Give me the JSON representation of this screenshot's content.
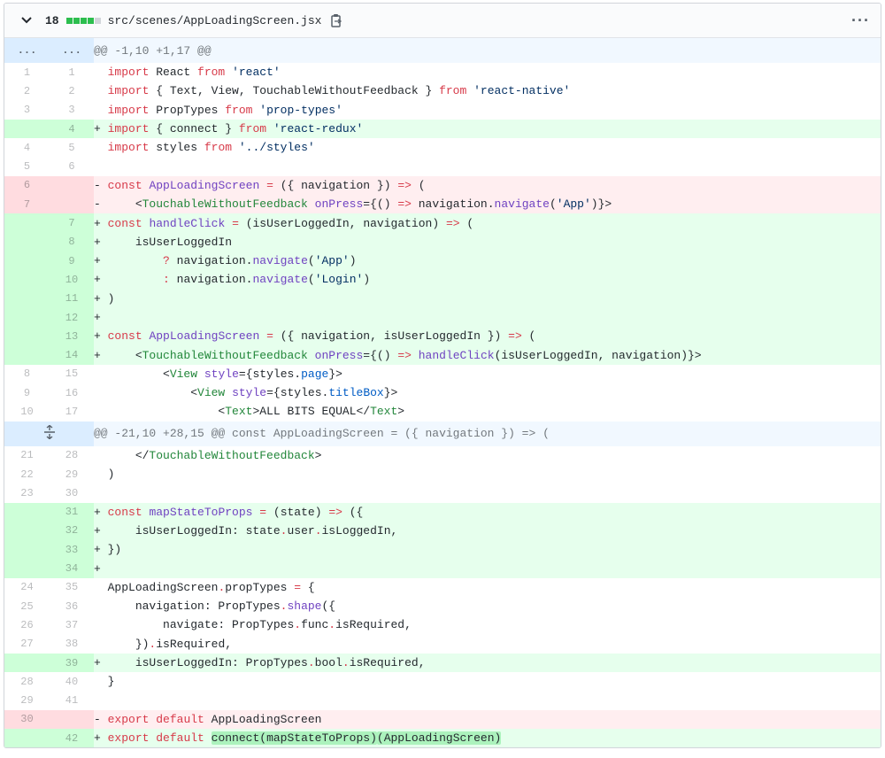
{
  "file": {
    "changes": "18",
    "stat_blocks": [
      "#2cbe4e",
      "#2cbe4e",
      "#2cbe4e",
      "#2cbe4e",
      "#d1d5da"
    ],
    "path": "src/scenes/AppLoadingScreen.jsx",
    "copy_icon": "clippy-icon",
    "menu_icon": "kebab-horizontal-icon",
    "menu_label": "···"
  },
  "hunks": [
    {
      "expander": "...",
      "expander2": "...",
      "header": "@@ -1,10 +1,17 @@"
    },
    {
      "expander": "unfold-icon",
      "header": "@@ -21,10 +28,15 @@ const AppLoadingScreen = ({ navigation }) => ("
    }
  ],
  "lines": [
    {
      "type": "ctx",
      "old": "1",
      "new": "1",
      "prefix": " ",
      "code": [
        {
          "t": "import",
          "c": "k"
        },
        {
          "t": " React "
        },
        {
          "t": "from",
          "c": "k"
        },
        {
          "t": " "
        },
        {
          "t": "'react'",
          "c": "s"
        }
      ]
    },
    {
      "type": "ctx",
      "old": "2",
      "new": "2",
      "prefix": " ",
      "code": [
        {
          "t": "import",
          "c": "k"
        },
        {
          "t": " { Text, View, TouchableWithoutFeedback } "
        },
        {
          "t": "from",
          "c": "k"
        },
        {
          "t": " "
        },
        {
          "t": "'react-native'",
          "c": "s"
        }
      ]
    },
    {
      "type": "ctx",
      "old": "3",
      "new": "3",
      "prefix": " ",
      "code": [
        {
          "t": "import",
          "c": "k"
        },
        {
          "t": " PropTypes "
        },
        {
          "t": "from",
          "c": "k"
        },
        {
          "t": " "
        },
        {
          "t": "'prop-types'",
          "c": "s"
        }
      ]
    },
    {
      "type": "add",
      "old": "",
      "new": "4",
      "prefix": "+",
      "code": [
        {
          "t": "import",
          "c": "k"
        },
        {
          "t": " { connect } "
        },
        {
          "t": "from",
          "c": "k"
        },
        {
          "t": " "
        },
        {
          "t": "'react-redux'",
          "c": "s"
        }
      ]
    },
    {
      "type": "ctx",
      "old": "4",
      "new": "5",
      "prefix": " ",
      "code": [
        {
          "t": "import",
          "c": "k"
        },
        {
          "t": " styles "
        },
        {
          "t": "from",
          "c": "k"
        },
        {
          "t": " "
        },
        {
          "t": "'../styles'",
          "c": "s"
        }
      ]
    },
    {
      "type": "ctx",
      "old": "5",
      "new": "6",
      "prefix": " ",
      "code": []
    },
    {
      "type": "del",
      "old": "6",
      "new": "",
      "prefix": "-",
      "code": [
        {
          "t": "const",
          "c": "k"
        },
        {
          "t": " "
        },
        {
          "t": "AppLoadingScreen",
          "c": "f"
        },
        {
          "t": " "
        },
        {
          "t": "=",
          "c": "k"
        },
        {
          "t": " ({ navigation }) "
        },
        {
          "t": "=>",
          "c": "k"
        },
        {
          "t": " ("
        }
      ]
    },
    {
      "type": "del",
      "old": "7",
      "new": "",
      "prefix": "-",
      "code": [
        {
          "t": "    <"
        },
        {
          "t": "TouchableWithoutFeedback",
          "c": "t"
        },
        {
          "t": " "
        },
        {
          "t": "onPress",
          "c": "f"
        },
        {
          "t": "="
        },
        {
          "t": "{() "
        },
        {
          "t": "=>",
          "c": "k"
        },
        {
          "t": " navigation."
        },
        {
          "t": "navigate",
          "c": "f"
        },
        {
          "t": "("
        },
        {
          "t": "'App'",
          "c": "s"
        },
        {
          "t": ")}>"
        }
      ]
    },
    {
      "type": "add",
      "old": "",
      "new": "7",
      "prefix": "+",
      "code": [
        {
          "t": "const",
          "c": "k"
        },
        {
          "t": " "
        },
        {
          "t": "handleClick",
          "c": "f"
        },
        {
          "t": " "
        },
        {
          "t": "=",
          "c": "k"
        },
        {
          "t": " (isUserLoggedIn, navigation) "
        },
        {
          "t": "=>",
          "c": "k"
        },
        {
          "t": " ("
        }
      ]
    },
    {
      "type": "add",
      "old": "",
      "new": "8",
      "prefix": "+",
      "code": [
        {
          "t": "    isUserLoggedIn"
        }
      ]
    },
    {
      "type": "add",
      "old": "",
      "new": "9",
      "prefix": "+",
      "code": [
        {
          "t": "        "
        },
        {
          "t": "?",
          "c": "k"
        },
        {
          "t": " navigation."
        },
        {
          "t": "navigate",
          "c": "f"
        },
        {
          "t": "("
        },
        {
          "t": "'App'",
          "c": "s"
        },
        {
          "t": ")"
        }
      ]
    },
    {
      "type": "add",
      "old": "",
      "new": "10",
      "prefix": "+",
      "code": [
        {
          "t": "        "
        },
        {
          "t": ":",
          "c": "k"
        },
        {
          "t": " navigation."
        },
        {
          "t": "navigate",
          "c": "f"
        },
        {
          "t": "("
        },
        {
          "t": "'Login'",
          "c": "s"
        },
        {
          "t": ")"
        }
      ]
    },
    {
      "type": "add",
      "old": "",
      "new": "11",
      "prefix": "+",
      "code": [
        {
          "t": ")"
        }
      ]
    },
    {
      "type": "add",
      "old": "",
      "new": "12",
      "prefix": "+",
      "code": []
    },
    {
      "type": "add",
      "old": "",
      "new": "13",
      "prefix": "+",
      "code": [
        {
          "t": "const",
          "c": "k"
        },
        {
          "t": " "
        },
        {
          "t": "AppLoadingScreen",
          "c": "f"
        },
        {
          "t": " "
        },
        {
          "t": "=",
          "c": "k"
        },
        {
          "t": " ({ navigation, isUserLoggedIn }) "
        },
        {
          "t": "=>",
          "c": "k"
        },
        {
          "t": " ("
        }
      ]
    },
    {
      "type": "add",
      "old": "",
      "new": "14",
      "prefix": "+",
      "code": [
        {
          "t": "    <"
        },
        {
          "t": "TouchableWithoutFeedback",
          "c": "t"
        },
        {
          "t": " "
        },
        {
          "t": "onPress",
          "c": "f"
        },
        {
          "t": "="
        },
        {
          "t": "{() "
        },
        {
          "t": "=>",
          "c": "k"
        },
        {
          "t": " "
        },
        {
          "t": "handleClick",
          "c": "f"
        },
        {
          "t": "(isUserLoggedIn, navigation)}>"
        }
      ]
    },
    {
      "type": "ctx",
      "old": "8",
      "new": "15",
      "prefix": " ",
      "code": [
        {
          "t": "        <"
        },
        {
          "t": "View",
          "c": "t"
        },
        {
          "t": " "
        },
        {
          "t": "style",
          "c": "f"
        },
        {
          "t": "="
        },
        {
          "t": "{styles."
        },
        {
          "t": "page",
          "c": "c"
        },
        {
          "t": "}>"
        }
      ]
    },
    {
      "type": "ctx",
      "old": "9",
      "new": "16",
      "prefix": " ",
      "code": [
        {
          "t": "            <"
        },
        {
          "t": "View",
          "c": "t"
        },
        {
          "t": " "
        },
        {
          "t": "style",
          "c": "f"
        },
        {
          "t": "="
        },
        {
          "t": "{styles."
        },
        {
          "t": "titleBox",
          "c": "c"
        },
        {
          "t": "}>"
        }
      ]
    },
    {
      "type": "ctx",
      "old": "10",
      "new": "17",
      "prefix": " ",
      "code": [
        {
          "t": "                <"
        },
        {
          "t": "Text",
          "c": "t"
        },
        {
          "t": ">ALL BITS EQUAL</"
        },
        {
          "t": "Text",
          "c": "t"
        },
        {
          "t": ">"
        }
      ]
    },
    {
      "hunk": 1
    },
    {
      "type": "ctx",
      "old": "21",
      "new": "28",
      "prefix": " ",
      "code": [
        {
          "t": "    </"
        },
        {
          "t": "TouchableWithoutFeedback",
          "c": "t"
        },
        {
          "t": ">"
        }
      ]
    },
    {
      "type": "ctx",
      "old": "22",
      "new": "29",
      "prefix": " ",
      "code": [
        {
          "t": ")"
        }
      ]
    },
    {
      "type": "ctx",
      "old": "23",
      "new": "30",
      "prefix": " ",
      "code": []
    },
    {
      "type": "add",
      "old": "",
      "new": "31",
      "prefix": "+",
      "code": [
        {
          "t": "const",
          "c": "k"
        },
        {
          "t": " "
        },
        {
          "t": "mapStateToProps",
          "c": "f"
        },
        {
          "t": " "
        },
        {
          "t": "=",
          "c": "k"
        },
        {
          "t": " (state) "
        },
        {
          "t": "=>",
          "c": "k"
        },
        {
          "t": " ({"
        }
      ]
    },
    {
      "type": "add",
      "old": "",
      "new": "32",
      "prefix": "+",
      "code": [
        {
          "t": "    isUserLoggedIn: state"
        },
        {
          "t": ".",
          "c": "k"
        },
        {
          "t": "user"
        },
        {
          "t": ".",
          "c": "k"
        },
        {
          "t": "isLoggedIn,"
        }
      ]
    },
    {
      "type": "add",
      "old": "",
      "new": "33",
      "prefix": "+",
      "code": [
        {
          "t": "})"
        }
      ]
    },
    {
      "type": "add",
      "old": "",
      "new": "34",
      "prefix": "+",
      "code": []
    },
    {
      "type": "ctx",
      "old": "24",
      "new": "35",
      "prefix": " ",
      "code": [
        {
          "t": "AppLoadingScreen"
        },
        {
          "t": ".",
          "c": "k"
        },
        {
          "t": "propTypes "
        },
        {
          "t": "=",
          "c": "k"
        },
        {
          "t": " {"
        }
      ]
    },
    {
      "type": "ctx",
      "old": "25",
      "new": "36",
      "prefix": " ",
      "code": [
        {
          "t": "    navigation: PropTypes"
        },
        {
          "t": ".",
          "c": "k"
        },
        {
          "t": "shape",
          "c": "f"
        },
        {
          "t": "({"
        }
      ]
    },
    {
      "type": "ctx",
      "old": "26",
      "new": "37",
      "prefix": " ",
      "code": [
        {
          "t": "        navigate: PropTypes"
        },
        {
          "t": ".",
          "c": "k"
        },
        {
          "t": "func"
        },
        {
          "t": ".",
          "c": "k"
        },
        {
          "t": "isRequired,"
        }
      ]
    },
    {
      "type": "ctx",
      "old": "27",
      "new": "38",
      "prefix": " ",
      "code": [
        {
          "t": "    })"
        },
        {
          "t": ".",
          "c": "k"
        },
        {
          "t": "isRequired,"
        }
      ]
    },
    {
      "type": "add",
      "old": "",
      "new": "39",
      "prefix": "+",
      "code": [
        {
          "t": "    isUserLoggedIn: PropTypes"
        },
        {
          "t": ".",
          "c": "k"
        },
        {
          "t": "bool"
        },
        {
          "t": ".",
          "c": "k"
        },
        {
          "t": "isRequired,"
        }
      ]
    },
    {
      "type": "ctx",
      "old": "28",
      "new": "40",
      "prefix": " ",
      "code": [
        {
          "t": "}"
        }
      ]
    },
    {
      "type": "ctx",
      "old": "29",
      "new": "41",
      "prefix": " ",
      "code": []
    },
    {
      "type": "del",
      "old": "30",
      "new": "",
      "prefix": "-",
      "code": [
        {
          "t": "export",
          "c": "k"
        },
        {
          "t": " "
        },
        {
          "t": "default",
          "c": "k"
        },
        {
          "t": " AppLoadingScreen"
        }
      ]
    },
    {
      "type": "add",
      "old": "",
      "new": "42",
      "prefix": "+",
      "code": [
        {
          "t": "export",
          "c": "k"
        },
        {
          "t": " "
        },
        {
          "t": "default",
          "c": "k"
        },
        {
          "t": " "
        },
        {
          "t": "connect(mapStateToProps)",
          "h": true
        },
        {
          "t": "(AppLoadingScreen)",
          "h": true
        }
      ]
    }
  ]
}
